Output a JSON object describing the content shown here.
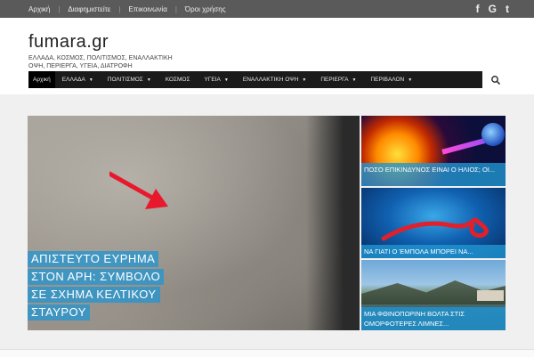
{
  "topbar": {
    "links": [
      "Αρχική",
      "Διαφημιστείτε",
      "Επικοινωνία",
      "Όροι χρήσης"
    ],
    "social": [
      {
        "icon": "facebook-icon",
        "glyph": "f"
      },
      {
        "icon": "google-plus-icon",
        "glyph": "G"
      },
      {
        "icon": "twitter-icon",
        "glyph": "t"
      }
    ]
  },
  "header": {
    "logo": "fumara.gr",
    "tagline": "ΕΛΛΑΔΑ, ΚΟΣΜΟΣ, ΠΟΛΙΤΙΣΜΟΣ, ΕΝΑΛΛΑΚΤΙΚΗ ΟΨΗ, ΠΕΡΙΕΡΓΑ, ΥΓΕΙΑ, ΔΙΑΤΡΟΦΗ"
  },
  "nav": {
    "items": [
      {
        "label": "Αρχική",
        "dropdown": false
      },
      {
        "label": "ΕΛΛΑΔΑ",
        "dropdown": true
      },
      {
        "label": "ΠΟΛΙΤΙΣΜΟΣ",
        "dropdown": true
      },
      {
        "label": "ΚΟΣΜΟΣ",
        "dropdown": false
      },
      {
        "label": "ΥΓΕΙΑ",
        "dropdown": true
      },
      {
        "label": "ΕΝΑΛΛΑΚΤΙΚΗ ΟΨΗ",
        "dropdown": true
      },
      {
        "label": "ΠΕΡΙΕΡΓΑ",
        "dropdown": true
      },
      {
        "label": "ΠΕΡΙΒΑΛΟΝ",
        "dropdown": true
      }
    ],
    "search_icon": "search-icon"
  },
  "featured": {
    "title_lines": [
      "ΑΠΙΣΤΕΥΤΟ ΕΥΡΗΜΑ",
      "ΣΤΟΝ ΑΡΗ: ΣΥΜΒΟΛΟ",
      "ΣΕ ΣΧΗΜΑ ΚΕΛΤΙΚΟΥ",
      "ΣΤΑΥΡΟΥ"
    ]
  },
  "side_posts": [
    {
      "title": "ΠΟΣΟ ΕΠΙΚΙΝΔΥΝΟΣ ΕΙΝΑΙ Ο ΗΛΙΟΣ; ΟΙ..."
    },
    {
      "title": "ΝΑ ΓΙΑΤΙ Ο ΈΜΠΟΛΑ ΜΠΟΡΕΙ ΝΑ..."
    },
    {
      "title": "ΜΙΑ ΦΘΙΝΟΠΩΡΙΝΗ ΒΟΛΤΑ ΣΤΙΣ ΟΜΟΡΦΟΤΕΡΕΣ ΛΙΜΝΕΣ..."
    }
  ],
  "colors": {
    "topbar": "#5a5a5a",
    "navbar": "#1b1b1b",
    "accent_overlay": "#2196d2"
  }
}
